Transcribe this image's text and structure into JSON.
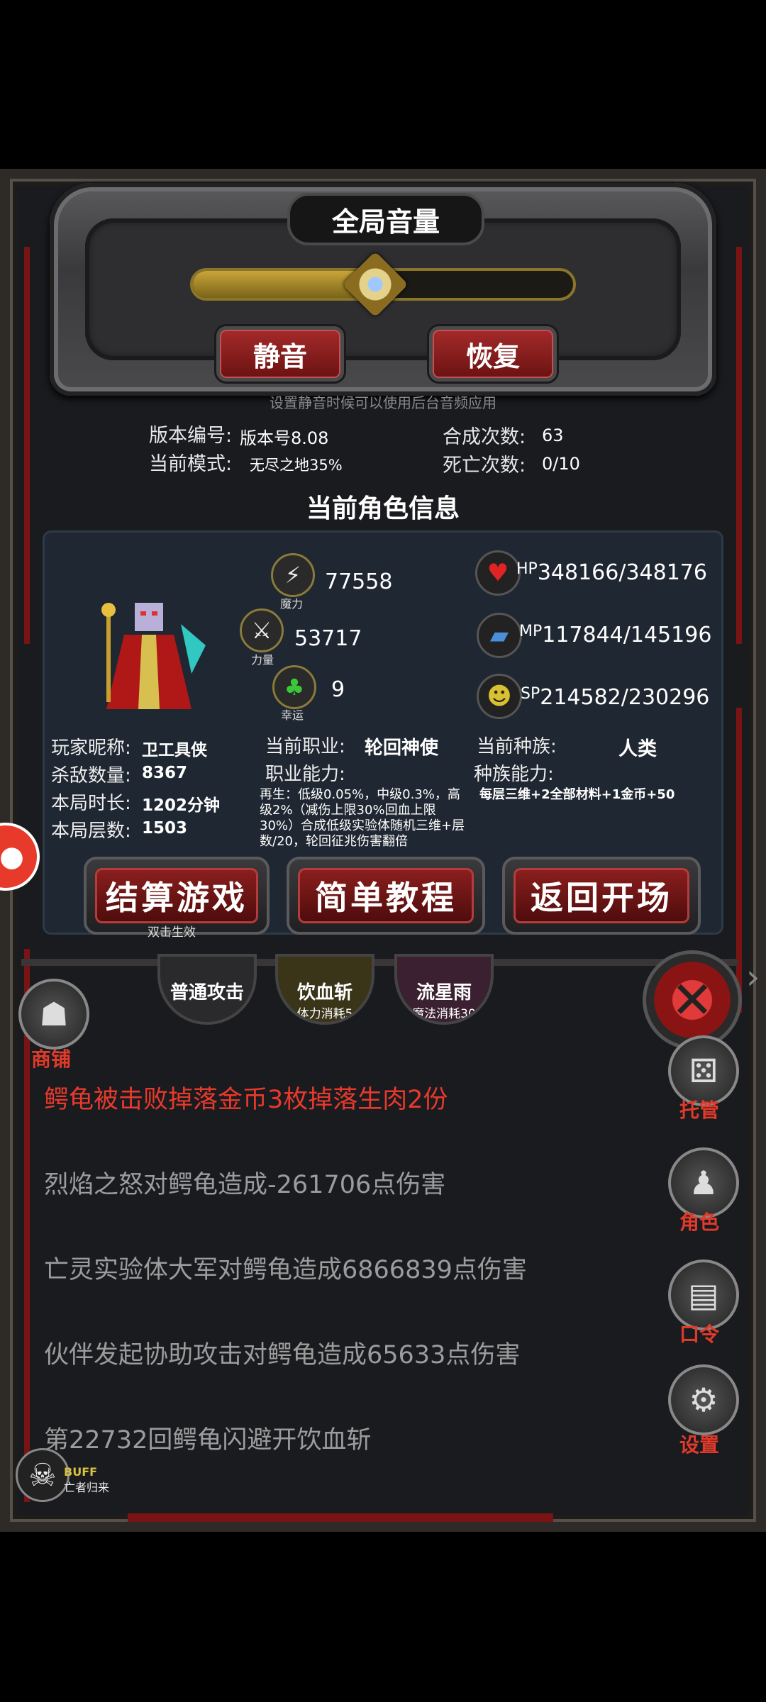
{
  "volume": {
    "title": "全局音量",
    "level_percent": 48,
    "mute_label": "静音",
    "restore_label": "恢复",
    "hint": "设置静音时候可以使用后台音频应用"
  },
  "game_info": {
    "version_label": "版本编号:",
    "version_value": "版本号8.08",
    "mode_label": "当前模式:",
    "mode_value": "无尽之地35%",
    "synth_label": "合成次数:",
    "synth_value": "63",
    "death_label": "死亡次数:",
    "death_value": "0/10"
  },
  "character": {
    "section_title": "当前角色信息",
    "magic_value": "77558",
    "magic_label": "魔力",
    "strength_value": "53717",
    "strength_label": "力量",
    "luck_value": "9",
    "luck_label": "幸运",
    "hp_tag": "HP",
    "hp_value": "348166/348176",
    "mp_tag": "MP",
    "mp_value": "117844/145196",
    "sp_tag": "SP",
    "sp_value": "214582/230296",
    "nickname_label": "玩家昵称:",
    "nickname_value": "卫工具侠",
    "kills_label": "杀敌数量:",
    "kills_value": "8367",
    "duration_label": "本局时长:",
    "duration_value": "1202分钟",
    "floor_label": "本局层数:",
    "floor_value": "1503",
    "job_label": "当前职业:",
    "job_value": "轮回神使",
    "job_ability_label": "职业能力:",
    "job_ability_text": "再生：低级0.05%，中级0.3%，高级2%（减伤上限30%回血上限30%）合成低级实验体随机三维+层数/20，轮回征兆伤害翻倍",
    "race_label": "当前种族:",
    "race_value": "人类",
    "race_ability_label": "种族能力:",
    "race_ability_text": "每层三维+2全部材料+1金币+50"
  },
  "actions": {
    "settle_label": "结算游戏",
    "settle_sub": "双击生效",
    "tutorial_label": "简单教程",
    "return_label": "返回开场"
  },
  "skills": [
    {
      "name": "普通攻击",
      "cost": ""
    },
    {
      "name": "饮血斩",
      "cost": "体力消耗5"
    },
    {
      "name": "流星雨",
      "cost": "魔法消耗30"
    }
  ],
  "sidebar": {
    "shop": "商铺",
    "auto": "托管",
    "role": "角色",
    "code": "口令",
    "settings": "设置"
  },
  "buff": {
    "title": "BUFF",
    "subtitle": "亡者归来"
  },
  "log": [
    "鳄龟被击败掉落金币3枚掉落生肉2份",
    "烈焰之怒对鳄龟造成-261706点伤害",
    "亡灵实验体大军对鳄龟造成6866839点伤害",
    "伙伴发起协助攻击对鳄龟造成65633点伤害",
    "第22732回鳄龟闪避开饮血斩"
  ],
  "colors": {
    "log_highlight": "#e8392c",
    "log_normal": "#9c9c9c",
    "accent_red": "#8a1e1e",
    "gold": "#c9a53a"
  }
}
